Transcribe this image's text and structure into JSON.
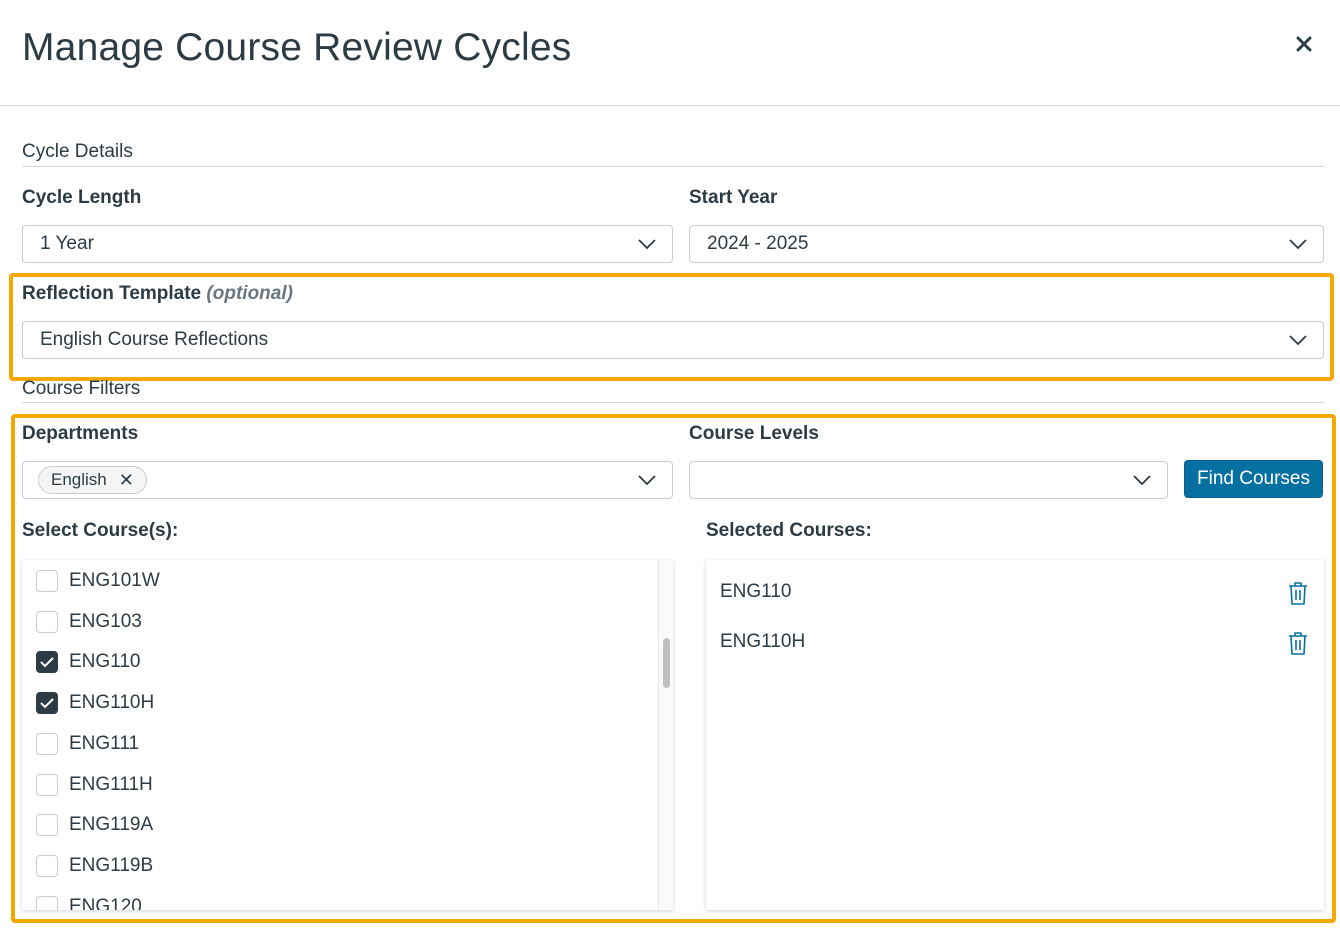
{
  "modal": {
    "title": "Manage Course Review Cycles",
    "close_icon": "close-icon"
  },
  "cycle_details": {
    "section_label": "Cycle Details",
    "cycle_length": {
      "label": "Cycle Length",
      "value": "1 Year"
    },
    "start_year": {
      "label": "Start Year",
      "value": "2024 - 2025"
    }
  },
  "reflection_template": {
    "label": "Reflection Template",
    "optional_label": "(optional)",
    "value": "English Course Reflections"
  },
  "course_filters": {
    "section_label": "Course Filters",
    "departments": {
      "label": "Departments",
      "tags": [
        "English"
      ]
    },
    "course_levels": {
      "label": "Course Levels",
      "value": ""
    },
    "find_button": "Find Courses"
  },
  "select_courses": {
    "label": "Select Course(s):",
    "items": [
      {
        "code": "ENG101W",
        "checked": false
      },
      {
        "code": "ENG103",
        "checked": false
      },
      {
        "code": "ENG110",
        "checked": true
      },
      {
        "code": "ENG110H",
        "checked": true
      },
      {
        "code": "ENG111",
        "checked": false
      },
      {
        "code": "ENG111H",
        "checked": false
      },
      {
        "code": "ENG119A",
        "checked": false
      },
      {
        "code": "ENG119B",
        "checked": false
      },
      {
        "code": "ENG120",
        "checked": false
      }
    ]
  },
  "selected_courses": {
    "label": "Selected Courses:",
    "items": [
      "ENG110",
      "ENG110H"
    ]
  },
  "colors": {
    "primary": "#0770a3",
    "highlight": "#f5a800",
    "text": "#2d3b45"
  }
}
